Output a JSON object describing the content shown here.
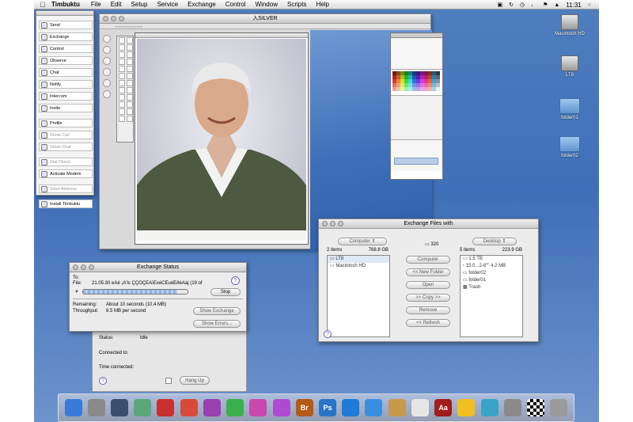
{
  "menubar": {
    "app_name": "Timbuktu",
    "items": [
      "File",
      "Edit",
      "Setup",
      "Service",
      "Exchange",
      "Control",
      "Window",
      "Scripts",
      "Help"
    ],
    "clock": "11:31"
  },
  "palette": {
    "items": [
      {
        "label": "Send",
        "enabled": true
      },
      {
        "label": "Exchange",
        "enabled": true
      },
      {
        "label": "Control",
        "enabled": true
      },
      {
        "label": "Observe",
        "enabled": true
      },
      {
        "label": "Chat",
        "enabled": true
      },
      {
        "label": "Notify",
        "enabled": true
      },
      {
        "label": "Intercom",
        "enabled": true
      },
      {
        "label": "Invite",
        "enabled": true
      },
      {
        "label": "Profile",
        "enabled": true
      },
      {
        "label": "Show Call",
        "enabled": false
      },
      {
        "label": "Show Chat",
        "enabled": false
      },
      {
        "label": "Dial Direct",
        "enabled": false
      },
      {
        "label": "Activate Modem",
        "enabled": true
      },
      {
        "label": "Save Address",
        "enabled": false
      },
      {
        "label": "Install Timbuktu",
        "enabled": true
      }
    ]
  },
  "photoshop_window": {
    "title": "入SILVER"
  },
  "exchange_files": {
    "title": "Exchange Files with",
    "left_volume": "Computer",
    "left_count": "2 items",
    "left_size": "768.8 GB",
    "left_items": [
      "LT8",
      "Macintosh HD"
    ],
    "middle_count": "320",
    "buttons": [
      "Computer",
      "<< New Folder",
      "Open",
      ">> Copy >>",
      "Remove",
      "<< Refresh"
    ],
    "right_volume": "Desktop",
    "right_count": "5 items",
    "right_size": "223.9 GB",
    "right_items": [
      "1.5 TB",
      "15.0...2-8\"\"   4.2 MB",
      "folder02",
      "folder01",
      "Trash"
    ]
  },
  "exchange_status": {
    "title": "Exchange Status",
    "to_label": "To:",
    "file_label": "File:",
    "file_value": "21.05.30 eAé ¡A′lc ÇÇOÇEAìExéCEuéEðéAàj  (19 of",
    "stop_label": "Stop",
    "remaining_label": "Remaining:",
    "remaining_value": "About 10 seconds (10.4 MB)",
    "throughput_label": "Throughput:",
    "throughput_value": "8.5 MB per second",
    "show_exchange": "Show Exchange",
    "show_errors": "Show Errors...",
    "progress": 0.9
  },
  "connection_panel": {
    "status_label": "Status:",
    "status_value": "Idle",
    "connected_to_label": "Connected to:",
    "time_connected_label": "Time connected:",
    "hang_up": "Hang Up"
  },
  "desktop_icons": [
    {
      "label": "Macintosh HD",
      "kind": "drive"
    },
    {
      "label": "LT8",
      "kind": "drive"
    },
    {
      "label": "folder01",
      "kind": "folder"
    },
    {
      "label": "folder02",
      "kind": "folder"
    }
  ],
  "dock_icons": [
    "finder-icon",
    "system-preferences-icon",
    "dashboard-icon",
    "time-machine-icon",
    "chair-icon",
    "ical-icon",
    "app-d-icon",
    "app-h-icon",
    "app-p-icon",
    "app-w-icon",
    "bridge-icon",
    "photoshop-icon",
    "ie-icon",
    "safari-icon",
    "preview-icon",
    "textedit-icon",
    "dictionary-icon",
    "adium-icon",
    "timbuktu-icon",
    "system-profiler-icon",
    "chess-icon",
    "trash-icon"
  ],
  "dock_labels": {
    "bridge": "Br",
    "photoshop": "Ps",
    "dictionary": "Aa"
  }
}
